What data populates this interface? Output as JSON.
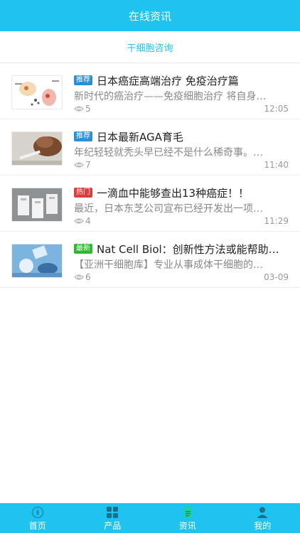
{
  "header": {
    "title": "在线资讯"
  },
  "subtab": {
    "label": "干细胞咨询"
  },
  "colors": {
    "accent": "#1ec4ef",
    "badge_recommend": "#2a8fd6",
    "badge_hot": "#e03c3c",
    "badge_new": "#2db92d"
  },
  "articles": [
    {
      "badge": "推荐",
      "badge_type": "recommend",
      "title": "日本癌症高端治疗 免疫治疗篇",
      "desc": "新时代的癌治疗——免疫细胞治疗 将自身…",
      "views": "5",
      "time": "12:05",
      "thumb": "cell-diagram-image"
    },
    {
      "badge": "推荐",
      "badge_type": "recommend",
      "title": "日本最新AGA育毛",
      "desc": "年纪轻轻就秃头早已经不是什么稀奇事。…",
      "views": "7",
      "time": "11:40",
      "thumb": "hair-treatment-image"
    },
    {
      "badge": "热门",
      "badge_type": "hot",
      "title": "一滴血中能够查出13种癌症！！",
      "desc": "最近，日本东芝公司宣布已经开发出一项…",
      "views": "4",
      "time": "11:29",
      "thumb": "test-chips-image"
    },
    {
      "badge": "最新",
      "badge_type": "new",
      "title": "Nat Cell Biol：创新性方法或能帮助…",
      "desc": "【亚洲干细胞库】专业从事成体干细胞的…",
      "views": "6",
      "time": "03-09",
      "thumb": "lab-research-image"
    }
  ],
  "tabbar": {
    "items": [
      {
        "label": "首页",
        "icon": "compass-icon"
      },
      {
        "label": "产品",
        "icon": "grid-icon"
      },
      {
        "label": "资讯",
        "icon": "document-icon"
      },
      {
        "label": "我的",
        "icon": "user-icon"
      }
    ]
  }
}
